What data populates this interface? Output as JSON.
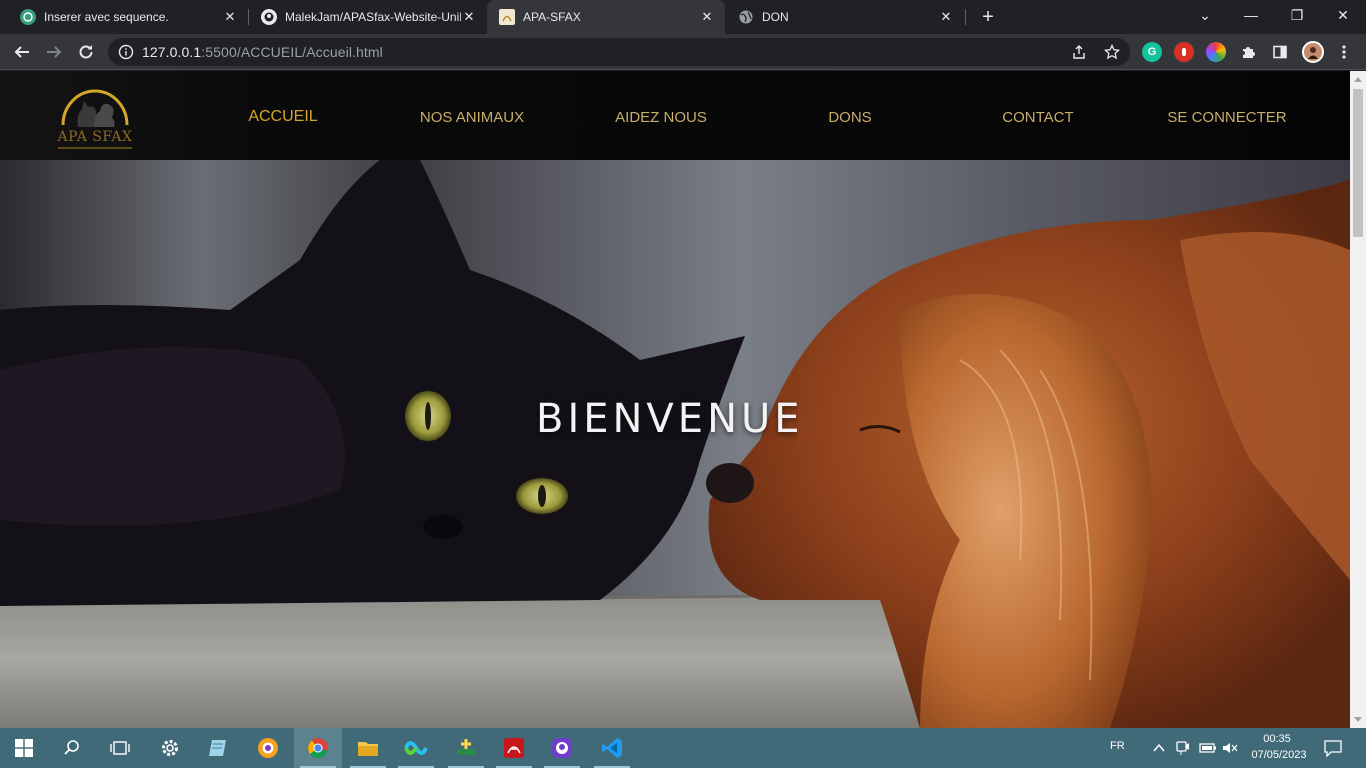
{
  "browser": {
    "tabs": [
      {
        "title": "Inserer avec sequence.",
        "icon": "openai-icon",
        "active": false
      },
      {
        "title": "MalekJam/APASfax-Website-UniF",
        "icon": "github-icon",
        "active": false
      },
      {
        "title": "APA-SFAX",
        "icon": "site-favicon",
        "active": true
      },
      {
        "title": "DON",
        "icon": "globe-icon",
        "active": false
      }
    ],
    "close_glyph": "✕",
    "new_tab_glyph": "+",
    "window_controls": {
      "dropdown": "⌄",
      "minimize": "—",
      "restore": "❐",
      "close": "✕"
    },
    "address": {
      "host": "127.0.0.1",
      "rest": ":5500/ACCUEIL/Accueil.html"
    }
  },
  "site": {
    "logo_text": "APA SFAX",
    "menu": [
      {
        "label": "ACCUEIL",
        "current": true
      },
      {
        "label": "NOS ANIMAUX",
        "current": false
      },
      {
        "label": "AIDEZ NOUS",
        "current": false
      },
      {
        "label": "DONS",
        "current": false
      },
      {
        "label": "CONTACT",
        "current": false
      },
      {
        "label": "SE CONNECTER",
        "current": false
      }
    ],
    "hero_title": "BIENVENUE",
    "colors": {
      "gold": "#d4a62a",
      "menu": "#c9ad6a"
    }
  },
  "taskbar": {
    "apps": [
      "windows-start-icon",
      "search-icon",
      "task-view-icon",
      "settings-icon",
      "notes-icon",
      "brave-icon",
      "chrome-icon",
      "file-explorer-icon",
      "webex-icon",
      "app-icon",
      "acrobat-icon",
      "github-desktop-icon",
      "vscode-icon"
    ],
    "language": "FR",
    "time": "00:35",
    "date": "07/05/2023"
  }
}
